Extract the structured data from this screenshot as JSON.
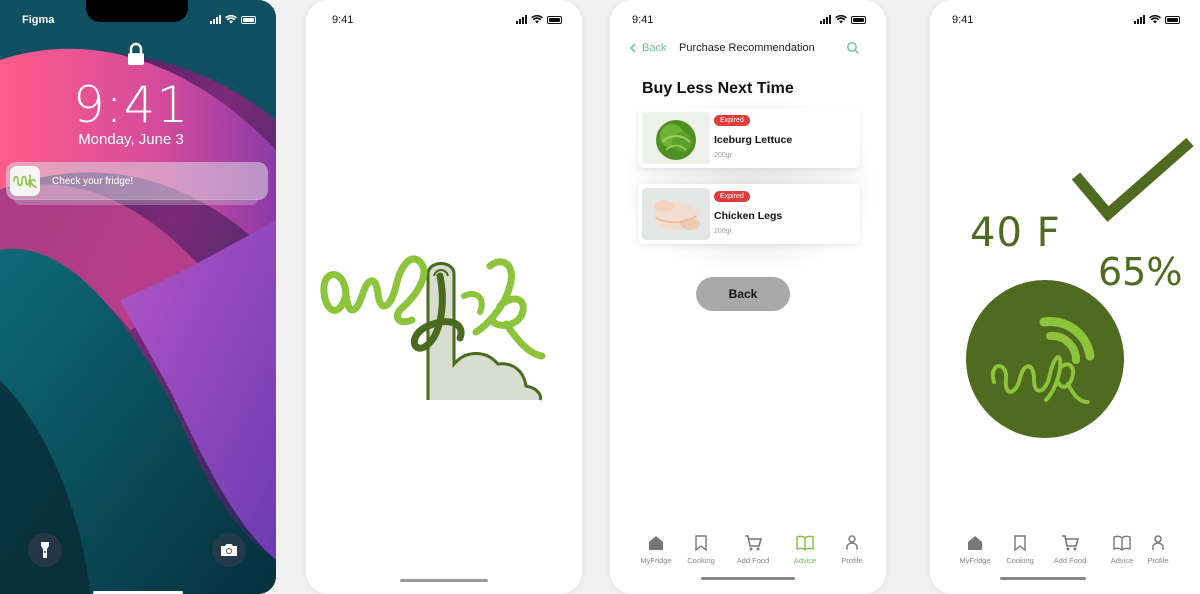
{
  "lock_screen": {
    "carrier": "Figma",
    "time": "9:41",
    "date": "Monday, June 3",
    "notification": {
      "message": "Check your fridge!"
    }
  },
  "splash": {
    "status_time": "9:41"
  },
  "recommendation": {
    "status_time": "9:41",
    "back_label": "Back",
    "title": "Purchase Recommendation",
    "heading": "Buy Less Next Time",
    "items": [
      {
        "badge": "Expired",
        "name": "Iceburg Lettuce",
        "weight": "200gr"
      },
      {
        "badge": "Expired",
        "name": "Chicken Legs",
        "weight": "200gr"
      }
    ],
    "back_button": "Back"
  },
  "tabs": [
    {
      "label": "MyFridge",
      "icon": "home-icon"
    },
    {
      "label": "Cooking",
      "icon": "bookmark-icon"
    },
    {
      "label": "Add Food",
      "icon": "cart-icon"
    },
    {
      "label": "Advice",
      "icon": "book-icon"
    },
    {
      "label": "Profile",
      "icon": "person-icon"
    }
  ],
  "active_tab_screen3": "Advice",
  "fridge_status": {
    "status_time": "9:41",
    "temperature": "40 F",
    "humidity": "65%"
  },
  "colors": {
    "brand_green": "#4e6b1f",
    "accent_green": "#7ac143",
    "expired_red": "#e03c3c",
    "back_link": "#6fbf8c"
  }
}
